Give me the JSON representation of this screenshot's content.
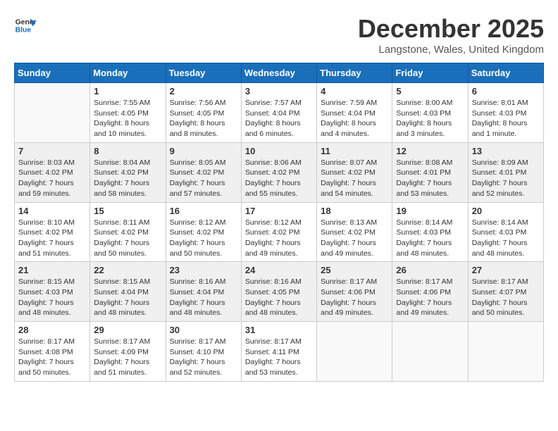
{
  "logo": {
    "line1": "General",
    "line2": "Blue"
  },
  "title": "December 2025",
  "subtitle": "Langstone, Wales, United Kingdom",
  "weekdays": [
    "Sunday",
    "Monday",
    "Tuesday",
    "Wednesday",
    "Thursday",
    "Friday",
    "Saturday"
  ],
  "weeks": [
    [
      {
        "day": "",
        "sunrise": "",
        "sunset": "",
        "daylight": ""
      },
      {
        "day": "1",
        "sunrise": "Sunrise: 7:55 AM",
        "sunset": "Sunset: 4:05 PM",
        "daylight": "Daylight: 8 hours and 10 minutes."
      },
      {
        "day": "2",
        "sunrise": "Sunrise: 7:56 AM",
        "sunset": "Sunset: 4:05 PM",
        "daylight": "Daylight: 8 hours and 8 minutes."
      },
      {
        "day": "3",
        "sunrise": "Sunrise: 7:57 AM",
        "sunset": "Sunset: 4:04 PM",
        "daylight": "Daylight: 8 hours and 6 minutes."
      },
      {
        "day": "4",
        "sunrise": "Sunrise: 7:59 AM",
        "sunset": "Sunset: 4:04 PM",
        "daylight": "Daylight: 8 hours and 4 minutes."
      },
      {
        "day": "5",
        "sunrise": "Sunrise: 8:00 AM",
        "sunset": "Sunset: 4:03 PM",
        "daylight": "Daylight: 8 hours and 3 minutes."
      },
      {
        "day": "6",
        "sunrise": "Sunrise: 8:01 AM",
        "sunset": "Sunset: 4:03 PM",
        "daylight": "Daylight: 8 hours and 1 minute."
      }
    ],
    [
      {
        "day": "7",
        "sunrise": "Sunrise: 8:03 AM",
        "sunset": "Sunset: 4:02 PM",
        "daylight": "Daylight: 7 hours and 59 minutes."
      },
      {
        "day": "8",
        "sunrise": "Sunrise: 8:04 AM",
        "sunset": "Sunset: 4:02 PM",
        "daylight": "Daylight: 7 hours and 58 minutes."
      },
      {
        "day": "9",
        "sunrise": "Sunrise: 8:05 AM",
        "sunset": "Sunset: 4:02 PM",
        "daylight": "Daylight: 7 hours and 57 minutes."
      },
      {
        "day": "10",
        "sunrise": "Sunrise: 8:06 AM",
        "sunset": "Sunset: 4:02 PM",
        "daylight": "Daylight: 7 hours and 55 minutes."
      },
      {
        "day": "11",
        "sunrise": "Sunrise: 8:07 AM",
        "sunset": "Sunset: 4:02 PM",
        "daylight": "Daylight: 7 hours and 54 minutes."
      },
      {
        "day": "12",
        "sunrise": "Sunrise: 8:08 AM",
        "sunset": "Sunset: 4:01 PM",
        "daylight": "Daylight: 7 hours and 53 minutes."
      },
      {
        "day": "13",
        "sunrise": "Sunrise: 8:09 AM",
        "sunset": "Sunset: 4:01 PM",
        "daylight": "Daylight: 7 hours and 52 minutes."
      }
    ],
    [
      {
        "day": "14",
        "sunrise": "Sunrise: 8:10 AM",
        "sunset": "Sunset: 4:02 PM",
        "daylight": "Daylight: 7 hours and 51 minutes."
      },
      {
        "day": "15",
        "sunrise": "Sunrise: 8:11 AM",
        "sunset": "Sunset: 4:02 PM",
        "daylight": "Daylight: 7 hours and 50 minutes."
      },
      {
        "day": "16",
        "sunrise": "Sunrise: 8:12 AM",
        "sunset": "Sunset: 4:02 PM",
        "daylight": "Daylight: 7 hours and 50 minutes."
      },
      {
        "day": "17",
        "sunrise": "Sunrise: 8:12 AM",
        "sunset": "Sunset: 4:02 PM",
        "daylight": "Daylight: 7 hours and 49 minutes."
      },
      {
        "day": "18",
        "sunrise": "Sunrise: 8:13 AM",
        "sunset": "Sunset: 4:02 PM",
        "daylight": "Daylight: 7 hours and 49 minutes."
      },
      {
        "day": "19",
        "sunrise": "Sunrise: 8:14 AM",
        "sunset": "Sunset: 4:03 PM",
        "daylight": "Daylight: 7 hours and 48 minutes."
      },
      {
        "day": "20",
        "sunrise": "Sunrise: 8:14 AM",
        "sunset": "Sunset: 4:03 PM",
        "daylight": "Daylight: 7 hours and 48 minutes."
      }
    ],
    [
      {
        "day": "21",
        "sunrise": "Sunrise: 8:15 AM",
        "sunset": "Sunset: 4:03 PM",
        "daylight": "Daylight: 7 hours and 48 minutes."
      },
      {
        "day": "22",
        "sunrise": "Sunrise: 8:15 AM",
        "sunset": "Sunset: 4:04 PM",
        "daylight": "Daylight: 7 hours and 48 minutes."
      },
      {
        "day": "23",
        "sunrise": "Sunrise: 8:16 AM",
        "sunset": "Sunset: 4:04 PM",
        "daylight": "Daylight: 7 hours and 48 minutes."
      },
      {
        "day": "24",
        "sunrise": "Sunrise: 8:16 AM",
        "sunset": "Sunset: 4:05 PM",
        "daylight": "Daylight: 7 hours and 48 minutes."
      },
      {
        "day": "25",
        "sunrise": "Sunrise: 8:17 AM",
        "sunset": "Sunset: 4:06 PM",
        "daylight": "Daylight: 7 hours and 49 minutes."
      },
      {
        "day": "26",
        "sunrise": "Sunrise: 8:17 AM",
        "sunset": "Sunset: 4:06 PM",
        "daylight": "Daylight: 7 hours and 49 minutes."
      },
      {
        "day": "27",
        "sunrise": "Sunrise: 8:17 AM",
        "sunset": "Sunset: 4:07 PM",
        "daylight": "Daylight: 7 hours and 50 minutes."
      }
    ],
    [
      {
        "day": "28",
        "sunrise": "Sunrise: 8:17 AM",
        "sunset": "Sunset: 4:08 PM",
        "daylight": "Daylight: 7 hours and 50 minutes."
      },
      {
        "day": "29",
        "sunrise": "Sunrise: 8:17 AM",
        "sunset": "Sunset: 4:09 PM",
        "daylight": "Daylight: 7 hours and 51 minutes."
      },
      {
        "day": "30",
        "sunrise": "Sunrise: 8:17 AM",
        "sunset": "Sunset: 4:10 PM",
        "daylight": "Daylight: 7 hours and 52 minutes."
      },
      {
        "day": "31",
        "sunrise": "Sunrise: 8:17 AM",
        "sunset": "Sunset: 4:11 PM",
        "daylight": "Daylight: 7 hours and 53 minutes."
      },
      {
        "day": "",
        "sunrise": "",
        "sunset": "",
        "daylight": ""
      },
      {
        "day": "",
        "sunrise": "",
        "sunset": "",
        "daylight": ""
      },
      {
        "day": "",
        "sunrise": "",
        "sunset": "",
        "daylight": ""
      }
    ]
  ]
}
